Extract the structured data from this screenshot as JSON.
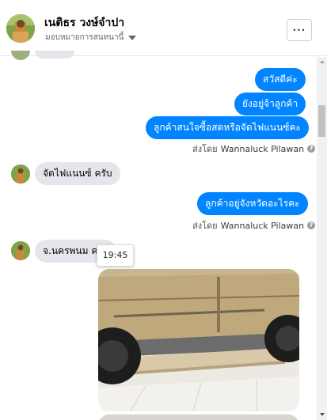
{
  "header": {
    "contact_name": "เนติธร วงษ์จำปา",
    "assign_label": "มอบหมายการสนทนานี้",
    "more_label": "···"
  },
  "messages": [
    {
      "direction": "outgoing",
      "text": "สวัสดีค่ะ"
    },
    {
      "direction": "outgoing",
      "text": "ยังอยู่จ้าลูกค้า"
    },
    {
      "direction": "outgoing",
      "text": "ลูกค้าสนใจซื้อสดหรือจัดไฟแนนซ์คะ"
    },
    {
      "direction": "incoming",
      "text": "จัดไฟแนนซ์ ครับ"
    },
    {
      "direction": "outgoing",
      "text": "ลูกค้าอยู่จังหวัดอะไรคะ"
    },
    {
      "direction": "incoming",
      "text": "จ.นครพนม ครับ"
    }
  ],
  "sent_by": {
    "label": "ส่งโดย",
    "name": "Wannaluck Pilawan",
    "help": "?"
  },
  "tooltip": {
    "time": "19:45"
  },
  "icons": {
    "more": "ellipsis-icon",
    "assign": "caret-down-icon",
    "help": "question-circle-icon"
  },
  "colors": {
    "outgoing_bubble": "#0084ff",
    "incoming_bubble": "#e4e6eb"
  }
}
